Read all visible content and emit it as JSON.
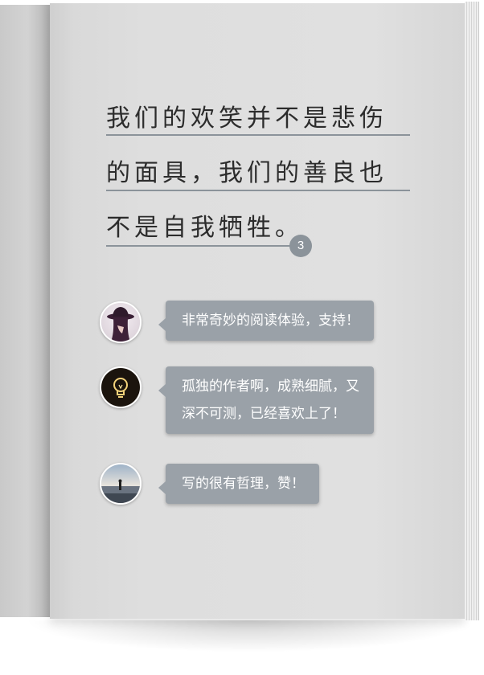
{
  "quote": {
    "lines": [
      "我们的欢笑并不是悲伤",
      "的面具，我们的善良也",
      "不是自我牺牲。"
    ],
    "page_number": "3"
  },
  "comments": [
    {
      "avatar": "woman-in-hat-avatar",
      "lines": [
        "非常奇妙的阅读体验，支持！"
      ]
    },
    {
      "avatar": "lightbulb-avatar",
      "lines": [
        "孤独的作者啊，成熟细腻，又",
        "深不可测，已经喜欢上了！"
      ]
    },
    {
      "avatar": "beach-person-avatar",
      "lines": [
        "写的很有哲理，赞！"
      ]
    }
  ],
  "colors": {
    "rule": "#8b939a",
    "bubble": "#9aa1a8",
    "text": "#2c2c2c"
  }
}
